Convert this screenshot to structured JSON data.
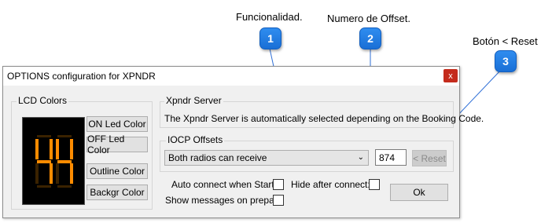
{
  "callouts": [
    {
      "number": "1",
      "label": "Funcionalidad."
    },
    {
      "number": "2",
      "label": "Numero de Offset."
    },
    {
      "number": "3",
      "label": "Botón < Reset"
    }
  ],
  "window": {
    "title": "OPTIONS configuration for XPNDR",
    "close_glyph": "x"
  },
  "lcd_colors": {
    "group_title": "LCD Colors",
    "display_digits": "44",
    "on_color": "#ff8c00",
    "buttons": {
      "on_led": "ON Led Color",
      "off_led": "OFF Led Color",
      "outline": "Outline Color",
      "background": "Backgr Color"
    }
  },
  "xpndr_server": {
    "group_title": "Xpndr Server",
    "message": "The Xpndr Server is automatically selected depending on the Booking Code."
  },
  "iocp_offsets": {
    "group_title": "IOCP Offsets",
    "selected_function": "Both radios can receive",
    "offset_value": "874",
    "reset_label": "< Reset"
  },
  "options": {
    "auto_connect_label": "Auto connect when Start:",
    "hide_after_connect_label": "Hide after connect:",
    "show_messages_label": "Show messages on prepar:",
    "ok_label": "Ok"
  },
  "colors": {
    "badge_blue": "#1a6fd6",
    "close_red": "#c42b1c"
  }
}
